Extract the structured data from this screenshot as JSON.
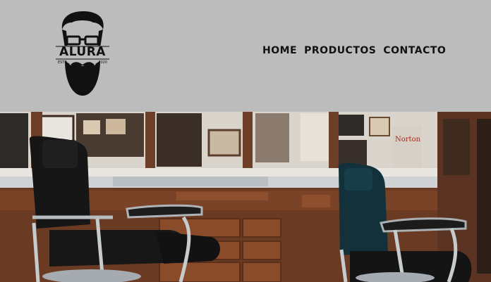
{
  "brand": {
    "name": "ALURA",
    "estd_label": "ESTD",
    "year": "2020"
  },
  "nav": {
    "items": [
      {
        "label": "HOME"
      },
      {
        "label": "PRODUCTOS"
      },
      {
        "label": "CONTACTO"
      }
    ]
  },
  "hero": {
    "image_alt": "Barbershop interior with vintage chairs",
    "signs": {
      "norton": "Norton"
    }
  }
}
